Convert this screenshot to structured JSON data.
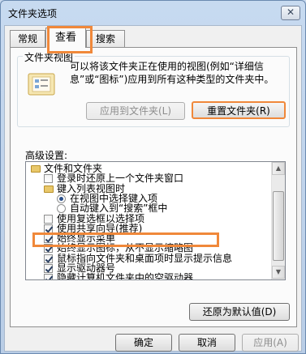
{
  "window": {
    "title": "文件夹选项",
    "close_glyph": "✕"
  },
  "tabs": [
    {
      "label": "常规",
      "active": false
    },
    {
      "label": "查看",
      "active": true
    },
    {
      "label": "搜索",
      "active": false
    }
  ],
  "folder_views": {
    "group_label": "文件夹视图",
    "description": "可以将该文件夹正在使用的视图(例如“详细信息”或“图标”)应用到所有这种类型的文件夹中。",
    "apply_button": "应用到文件夹(L)",
    "reset_button": "重置文件夹(R)"
  },
  "advanced": {
    "label": "高级设置:",
    "items": [
      {
        "type": "folder",
        "indent": 0,
        "label": "文件和文件夹"
      },
      {
        "type": "checkbox",
        "indent": 1,
        "checked": false,
        "label": "登录时还原上一个文件夹窗口"
      },
      {
        "type": "folder",
        "indent": 1,
        "label": "键入列表视图时"
      },
      {
        "type": "radio",
        "indent": 2,
        "checked": true,
        "label": "在视图中选择键入项"
      },
      {
        "type": "radio",
        "indent": 2,
        "checked": false,
        "label": "自动键入到“搜索”框中"
      },
      {
        "type": "checkbox",
        "indent": 1,
        "checked": false,
        "label": "使用复选框以选择项"
      },
      {
        "type": "checkbox",
        "indent": 1,
        "checked": true,
        "label": "使用共享向导(推荐)"
      },
      {
        "type": "checkbox",
        "indent": 1,
        "checked": true,
        "label": "始终显示菜单"
      },
      {
        "type": "checkbox",
        "indent": 1,
        "checked": true,
        "label": "始终显示图标，从不显示缩略图"
      },
      {
        "type": "checkbox",
        "indent": 1,
        "checked": true,
        "label": "鼠标指向文件夹和桌面项时显示提示信息"
      },
      {
        "type": "checkbox",
        "indent": 1,
        "checked": true,
        "label": "显示驱动器号"
      },
      {
        "type": "checkbox",
        "indent": 1,
        "checked": true,
        "label": "隐藏计算机文件夹中的空驱动器"
      },
      {
        "type": "checkbox",
        "indent": 1,
        "checked": true,
        "label": "隐藏受保护的操作系统文件(推荐)"
      }
    ],
    "restore_button": "还原为默认值(D)"
  },
  "footer": {
    "ok_button": "确定",
    "cancel_button": "取消",
    "apply_button": "应用(A)"
  },
  "colors": {
    "highlight": "#f0883a",
    "title_gradient": "#c7daf0"
  },
  "icons": {
    "folder": "folder-icon",
    "close": "close-icon",
    "scroll_up": "scroll-up-icon",
    "scroll_down": "scroll-down-icon"
  }
}
